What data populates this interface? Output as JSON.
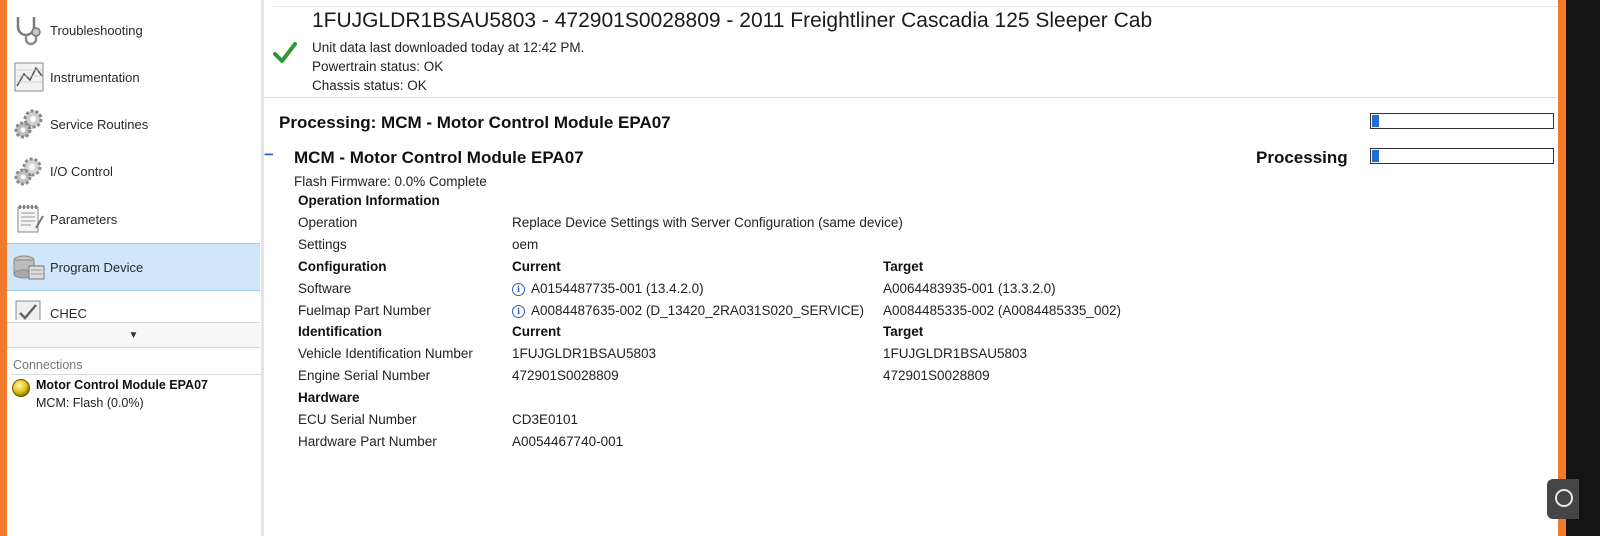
{
  "sidebar": {
    "items": [
      {
        "label": "Troubleshooting",
        "icon": "stethoscope-icon"
      },
      {
        "label": "Instrumentation",
        "icon": "chart-icon"
      },
      {
        "label": "Service Routines",
        "icon": "gears-icon"
      },
      {
        "label": "I/O Control",
        "icon": "gears-icon"
      },
      {
        "label": "Parameters",
        "icon": "notepad-icon"
      },
      {
        "label": "Program Device",
        "icon": "program-device-icon",
        "selected": true
      },
      {
        "label": "CHEC",
        "icon": "checklist-icon"
      }
    ],
    "connections_header": "Connections",
    "connection": {
      "title": "Motor Control Module EPA07",
      "status": "MCM: Flash (0.0%)"
    }
  },
  "header": {
    "title": "1FUJGLDR1BSAU5803 - 472901S0028809 - 2011 Freightliner Cascadia 125 Sleeper Cab",
    "line1": "Unit data last downloaded today at 12:42 PM.",
    "line2": "Powertrain status: OK",
    "line3": "Chassis status: OK"
  },
  "processing": {
    "title": "Processing: MCM - Motor Control Module EPA07",
    "progress_fraction": 0.04
  },
  "module": {
    "title": "MCM - Motor Control Module EPA07",
    "collapse_symbol": "−",
    "status": "Processing",
    "progress_fraction": 0.04,
    "flash_text": "Flash Firmware: 0.0% Complete"
  },
  "operation_info": {
    "heading": "Operation Information",
    "rows": [
      {
        "label": "Operation",
        "value": "Replace Device Settings with Server Configuration (same device)"
      },
      {
        "label": "Settings",
        "value": "oem"
      }
    ]
  },
  "configuration": {
    "heading": "Configuration",
    "current_header": "Current",
    "target_header": "Target",
    "rows": [
      {
        "label": "Software",
        "current": "A0154487735-001 (13.4.2.0)",
        "target": "A0064483935-001 (13.3.2.0)"
      },
      {
        "label": "Fuelmap Part Number",
        "current": "A0084487635-002 (D_13420_2RA031S020_SERVICE)",
        "target": "A0084485335-002 (A0084485335_002)"
      }
    ]
  },
  "identification": {
    "heading": "Identification",
    "current_header": "Current",
    "target_header": "Target",
    "rows": [
      {
        "label": "Vehicle Identification Number",
        "current": "1FUJGLDR1BSAU5803",
        "target": "1FUJGLDR1BSAU5803"
      },
      {
        "label": "Engine Serial Number",
        "current": "472901S0028809",
        "target": "472901S0028809"
      }
    ]
  },
  "hardware": {
    "heading": "Hardware",
    "rows": [
      {
        "label": "ECU Serial Number",
        "value": "CD3E0101"
      },
      {
        "label": "Hardware Part Number",
        "value": "A0054467740-001"
      }
    ]
  },
  "colors": {
    "accent_frame": "#f07a2c",
    "progress_fill": "#1f6fd1",
    "selection_bg": "#cfe6fb",
    "check_green": "#2e9a33"
  }
}
